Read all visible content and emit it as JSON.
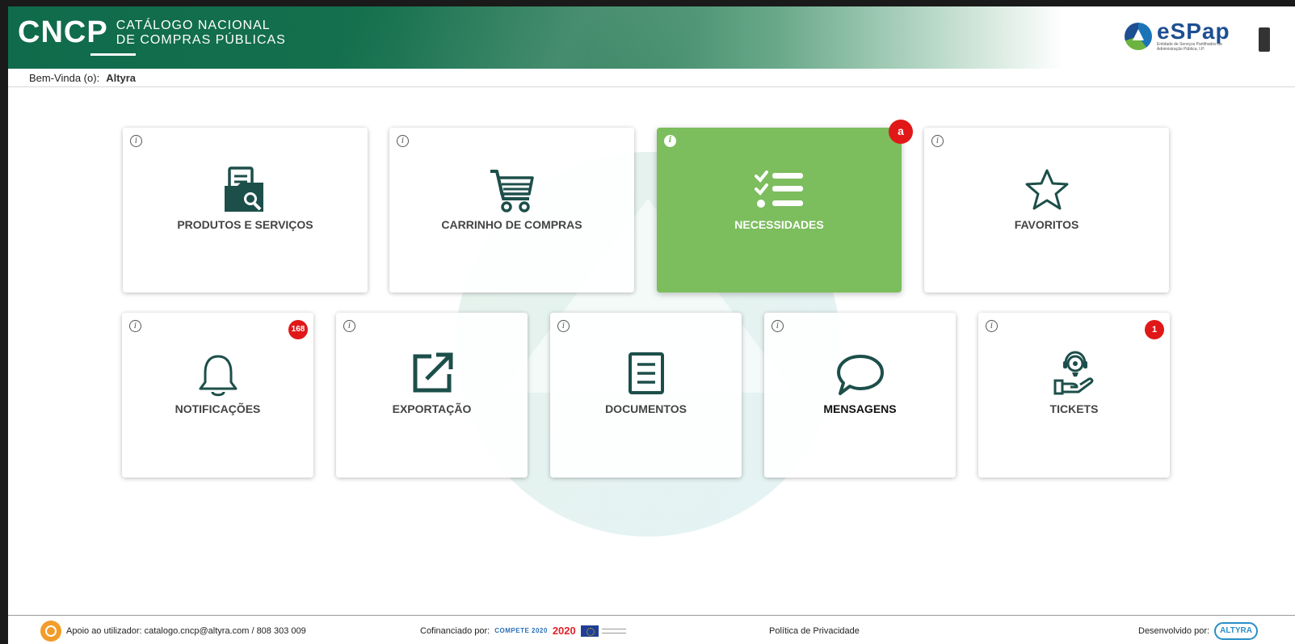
{
  "header": {
    "brand_short": "CNCP",
    "brand_line1": "CATÁLOGO NACIONAL",
    "brand_line2": "DE COMPRAS PÚBLICAS",
    "partner_logo": "eSPap",
    "partner_sub": "Entidade de Serviços Partilhados da Administração Pública, I.P."
  },
  "welcome": {
    "label": "Bem-Vinda (o):",
    "user": "Altyra"
  },
  "info_glyph": "i",
  "tiles": [
    {
      "label": "PRODUTOS E SERVIÇOS",
      "icon": "documents-search-icon"
    },
    {
      "label": "CARRINHO DE COMPRAS",
      "icon": "shopping-cart-icon"
    },
    {
      "label": "NECESSIDADES",
      "icon": "checklist-icon",
      "active": true,
      "badge": "a"
    },
    {
      "label": "FAVORITOS",
      "icon": "star-icon"
    },
    {
      "label": "NOTIFICAÇÕES",
      "icon": "bell-icon",
      "badge": "168"
    },
    {
      "label": "EXPORTAÇÃO",
      "icon": "export-icon"
    },
    {
      "label": "DOCUMENTOS",
      "icon": "document-icon"
    },
    {
      "label": "MENSAGENS",
      "icon": "chat-bubble-icon"
    },
    {
      "label": "TICKETS",
      "icon": "support-agent-icon",
      "badge": "1"
    }
  ],
  "footer": {
    "support": "Apoio ao utilizador: catalogo.cncp@altyra.com / 808 303 009",
    "cofin_label": "Cofinanciado por:",
    "compete": "COMPETE 2020",
    "pt2020": "2020",
    "privacy": "Política de Privacidade",
    "dev_label": "Desenvolvido por:",
    "dev_logo": "ALTYRA"
  },
  "colors": {
    "brand_green": "#0f6b4b",
    "active_tile": "#7cbd5e",
    "badge_red": "#e01818",
    "icon_teal": "#1d4f4a"
  }
}
